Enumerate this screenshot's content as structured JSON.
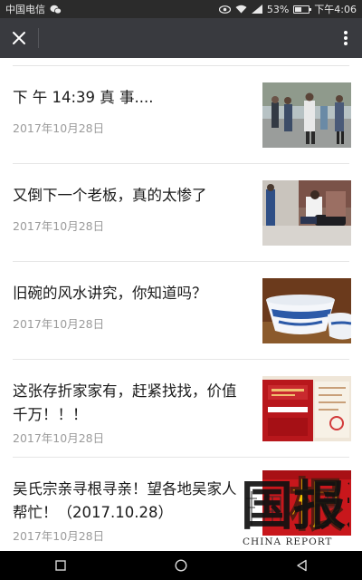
{
  "status_bar": {
    "carrier": "中国电信",
    "battery": "53%",
    "battery_level": 0.53,
    "time": "下午4:06",
    "icons": [
      "wechat-icon",
      "eye-icon",
      "wifi-icon",
      "signal-icon",
      "battery-icon"
    ]
  },
  "top_bar": {
    "close_icon": "close-icon",
    "more_icon": "more-vertical-icon"
  },
  "articles": [
    {
      "title": "下 午 14:39 真 事....",
      "date": "2017年10月28日",
      "thumb": "photo-street-scene"
    },
    {
      "title": "又倒下一个老板，真的太惨了",
      "date": "2017年10月28日",
      "thumb": "photo-man-collapsed"
    },
    {
      "title": "旧碗的风水讲究，你知道吗？",
      "date": "2017年10月28日",
      "thumb": "photo-porcelain-bowls"
    },
    {
      "title": "这张存折家家有，赶紧找找，价值千万！！！",
      "date": "2017年10月28日",
      "thumb": "photo-bankbook"
    },
    {
      "title": "吴氏宗亲寻根寻亲！望各地吴家人帮忙！（2017.10.28）",
      "date": "2017年10月28日",
      "thumb": "photo-root-calligraphy",
      "thumb_text": "根"
    }
  ],
  "watermark": {
    "characters": "中国报道",
    "text": "CHINA REPORT"
  },
  "nav_bar": {
    "icons": [
      "recent-apps-icon",
      "home-icon",
      "back-icon"
    ]
  },
  "colors": {
    "status_bar_bg": "#2b2b2b",
    "top_bar_bg": "#393a3f",
    "title_text": "#1a1a1a",
    "date_text": "#9b9b9b",
    "nav_bar_bg": "#000000"
  }
}
